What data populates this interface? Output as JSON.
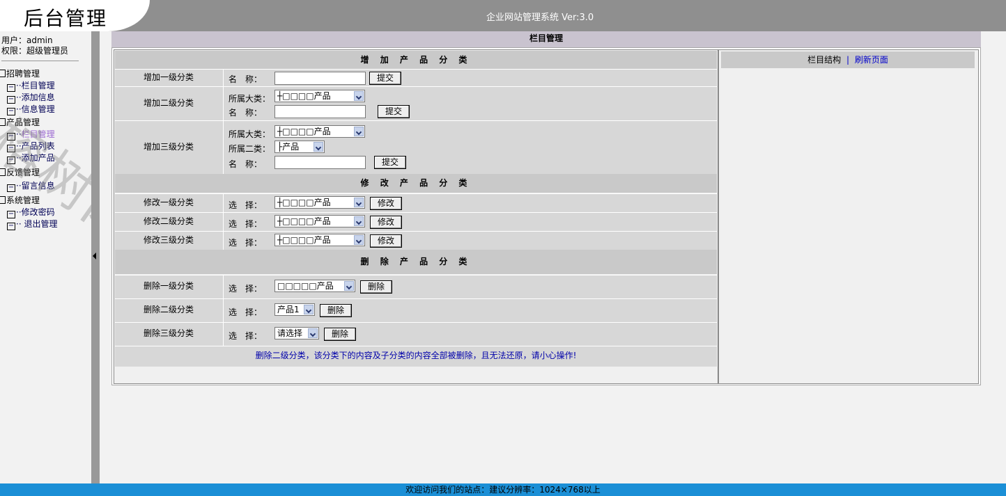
{
  "header": {
    "logo": "后台管理",
    "app_title": "企业网站管理系统  Ver:3.0"
  },
  "user": {
    "name_label": "用户：admin",
    "role_label": "权限：超级管理员"
  },
  "sidebar": {
    "groups": [
      {
        "label": "招聘管理",
        "items": [
          "栏目管理",
          "添加信息",
          "信息管理"
        ]
      },
      {
        "label": "产品管理",
        "items": [
          "栏目管理",
          "产品列表",
          "添加产品"
        ]
      },
      {
        "label": "反馈管理",
        "items": [
          "留言信息"
        ]
      },
      {
        "label": "系统管理",
        "items": [
          "修改密码",
          "退出管理"
        ]
      }
    ]
  },
  "watermark": "榕树网络",
  "main": {
    "title": "栏目管理",
    "add_section": "增 加 产 品 分 类",
    "modify_section": "修 改 产 品 分 类",
    "delete_section": "删 除 产 品 分 类",
    "labels": {
      "add1": "增加一级分类",
      "add2": "增加二级分类",
      "add3": "增加三级分类",
      "mod1": "修改一级分类",
      "mod2": "修改二级分类",
      "mod3": "修改三级分类",
      "del1": "删除一级分类",
      "del2": "删除二级分类",
      "del3": "删除三级分类"
    },
    "field": {
      "name": "名　称：",
      "parent1": "所属大类：",
      "parent2": "所属二类：",
      "choose": "选　择："
    },
    "selects": {
      "major": "┼□□□□产品",
      "minor": "├产品",
      "del1": "□□□□□产品",
      "del2": "产品1",
      "del3": "请选择"
    },
    "buttons": {
      "submit": "提交",
      "modify": "修改",
      "delete": "删除"
    },
    "warning": "删除二级分类，该分类下的内容及子分类的内容全部被删除，且无法还原，请小心操作!"
  },
  "right_panel": {
    "structure": "栏目结构",
    "divider": "|",
    "refresh": "刷新页面"
  },
  "footer": "欢迎访问我们的站点：建议分辨率：1024×768以上"
}
